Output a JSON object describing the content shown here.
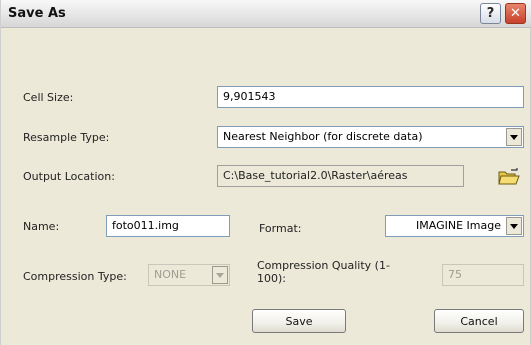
{
  "window": {
    "title": "Save As",
    "help_glyph": "?",
    "close_glyph": "✕",
    "help_icon": "help-icon",
    "close_icon": "close-icon"
  },
  "form": {
    "cell_size": {
      "label": "Cell Size:",
      "value": "9,901543"
    },
    "resample_type": {
      "label": "Resample Type:",
      "value": "Nearest Neighbor (for discrete data)"
    },
    "output_location": {
      "label": "Output Location:",
      "value": "C:\\Base_tutorial2.0\\Raster\\aéreas",
      "browse_icon": "folder-open-icon"
    },
    "name": {
      "label": "Name:",
      "value": "foto011.img"
    },
    "format": {
      "label": "Format:",
      "value": "IMAGINE Image"
    },
    "compression_type": {
      "label": "Compression Type:",
      "value": "NONE"
    },
    "compression_quality": {
      "label": "Compression Quality (1-100):",
      "value": "75"
    }
  },
  "buttons": {
    "save": "Save",
    "cancel": "Cancel"
  },
  "colors": {
    "dialog_bg": "#ece9d8",
    "close_red": "#c8402a",
    "field_border": "#7f9db9"
  }
}
